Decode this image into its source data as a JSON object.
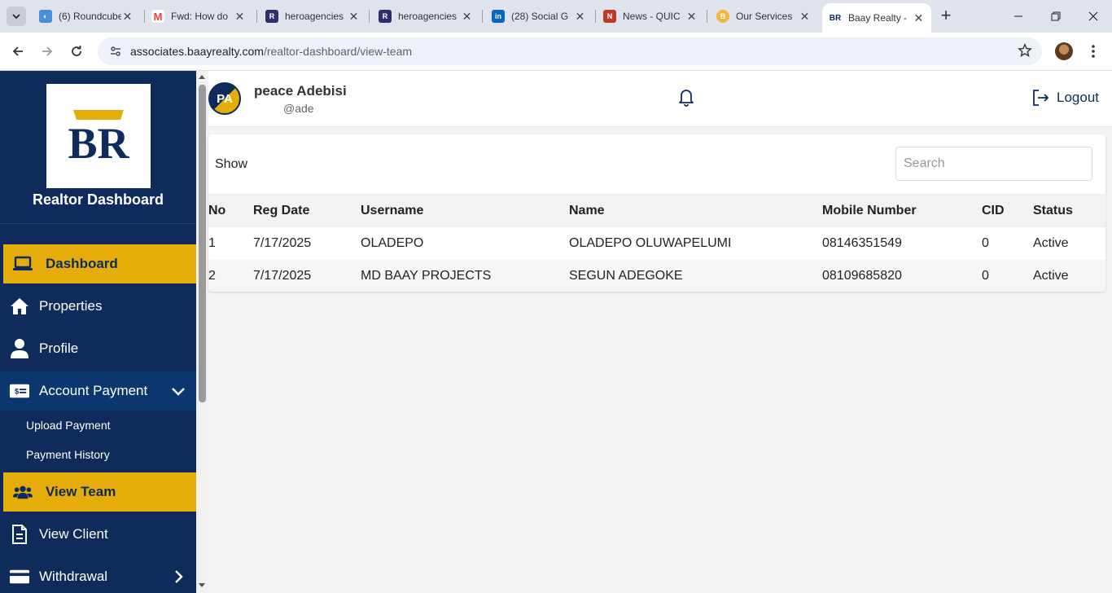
{
  "browser": {
    "tabs": [
      {
        "title": "(6) Roundcube",
        "color": "#4a90d9",
        "glyph": "◐"
      },
      {
        "title": "Fwd: How do",
        "color": "#ea4335",
        "glyph": "M"
      },
      {
        "title": "heroagencies",
        "color": "#2d2f6b",
        "glyph": "R"
      },
      {
        "title": "heroagencies",
        "color": "#2d2f6b",
        "glyph": "R"
      },
      {
        "title": "(28) Social G",
        "color": "#0a66c2",
        "glyph": "in"
      },
      {
        "title": "News - QUIC",
        "color": "#c0392b",
        "glyph": "N"
      },
      {
        "title": "Our Services",
        "color": "#f0b73a",
        "glyph": "B"
      },
      {
        "title": "Baay Realty -",
        "color": "#0f2b5b",
        "glyph": "BR"
      }
    ],
    "url_host": "associates.baayrealty.com",
    "url_path": "/realtor-dashboard/view-team"
  },
  "sidebar": {
    "brand_title": "Realtor Dashboard",
    "logo_text": "BR",
    "items": [
      {
        "label": "Dashboard"
      },
      {
        "label": "Properties"
      },
      {
        "label": "Profile"
      },
      {
        "label": "Account Payment"
      },
      {
        "label": "View Team"
      },
      {
        "label": "View Client"
      },
      {
        "label": "Withdrawal"
      }
    ],
    "sub_items": [
      {
        "label": "Upload Payment"
      },
      {
        "label": "Payment History"
      }
    ]
  },
  "header": {
    "avatar_initials": "PA",
    "user_name": "peace Adebisi",
    "user_handle": "@ade",
    "logout_label": "Logout"
  },
  "table": {
    "show_label": "Show",
    "search_placeholder": "Search",
    "columns": [
      "No",
      "Reg Date",
      "Username",
      "Name",
      "Mobile Number",
      "CID",
      "Status"
    ],
    "rows": [
      [
        "1",
        "7/17/2025",
        "OLADEPO",
        "OLADEPO OLUWAPELUMI",
        "08146351549",
        "0",
        "Active"
      ],
      [
        "2",
        "7/17/2025",
        "MD BAAY PROJECTS",
        "SEGUN ADEGOKE",
        "08109685820",
        "0",
        "Active"
      ]
    ]
  },
  "colors": {
    "sidebar_bg": "#0f2b5b",
    "accent_gold": "#e4ad0a"
  }
}
